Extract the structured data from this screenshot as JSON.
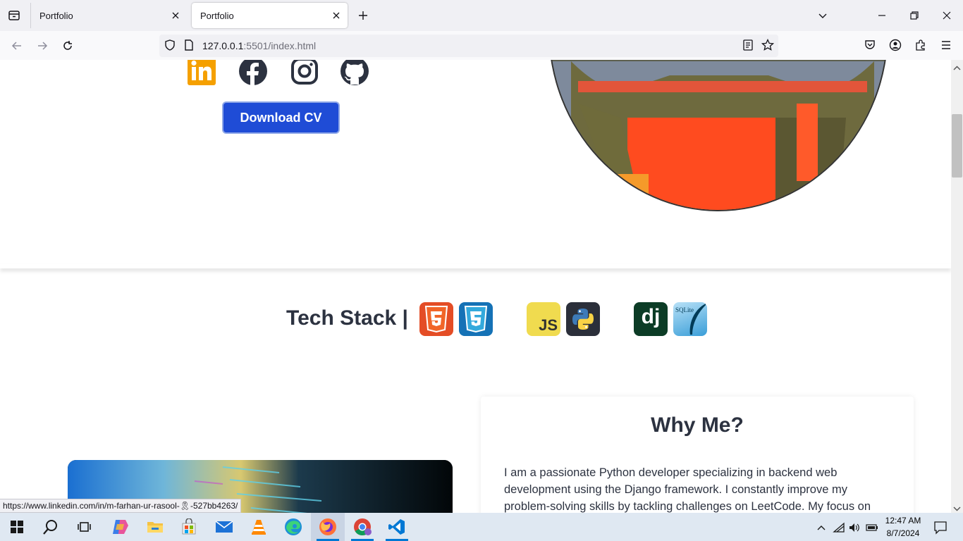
{
  "browser": {
    "tabs": [
      {
        "title": "Portfolio",
        "active": false
      },
      {
        "title": "Portfolio",
        "active": true
      }
    ],
    "url_host": "127.0.0.1",
    "url_rest": ":5501/index.html",
    "status_link": "https://www.linkedin.com/in/m-farhan-ur-rasool-🎗-527bb4263/"
  },
  "hero": {
    "social_icons": [
      "linkedin-icon",
      "facebook-icon",
      "instagram-icon",
      "github-icon"
    ],
    "cv_button": "Download CV"
  },
  "tech_stack": {
    "title": "Tech Stack |",
    "icons": [
      "html5-icon",
      "css3-icon",
      "javascript-icon",
      "python-icon",
      "django-icon",
      "sqlite-icon"
    ],
    "js_label": "JS",
    "dj_label": "dj",
    "sqlite_label": "SQLite"
  },
  "why_me": {
    "title": "Why Me?",
    "text": "I am a passionate Python developer specializing in backend web development using the Django framework. I constantly improve my problem-solving skills by tackling challenges on LeetCode. My focus on"
  },
  "taskbar": {
    "apps": [
      "start-icon",
      "search-icon",
      "task-view-icon",
      "copilot-icon",
      "file-explorer-icon",
      "store-icon",
      "mail-icon",
      "vlc-icon",
      "edge-icon",
      "firefox-icon",
      "chrome-icon",
      "vscode-icon"
    ],
    "time": "12:47 AM",
    "date": "8/7/2024"
  },
  "colors": {
    "accent": "#1f4cd6",
    "linkedin": "#f5a000",
    "heading": "#2c3240"
  }
}
